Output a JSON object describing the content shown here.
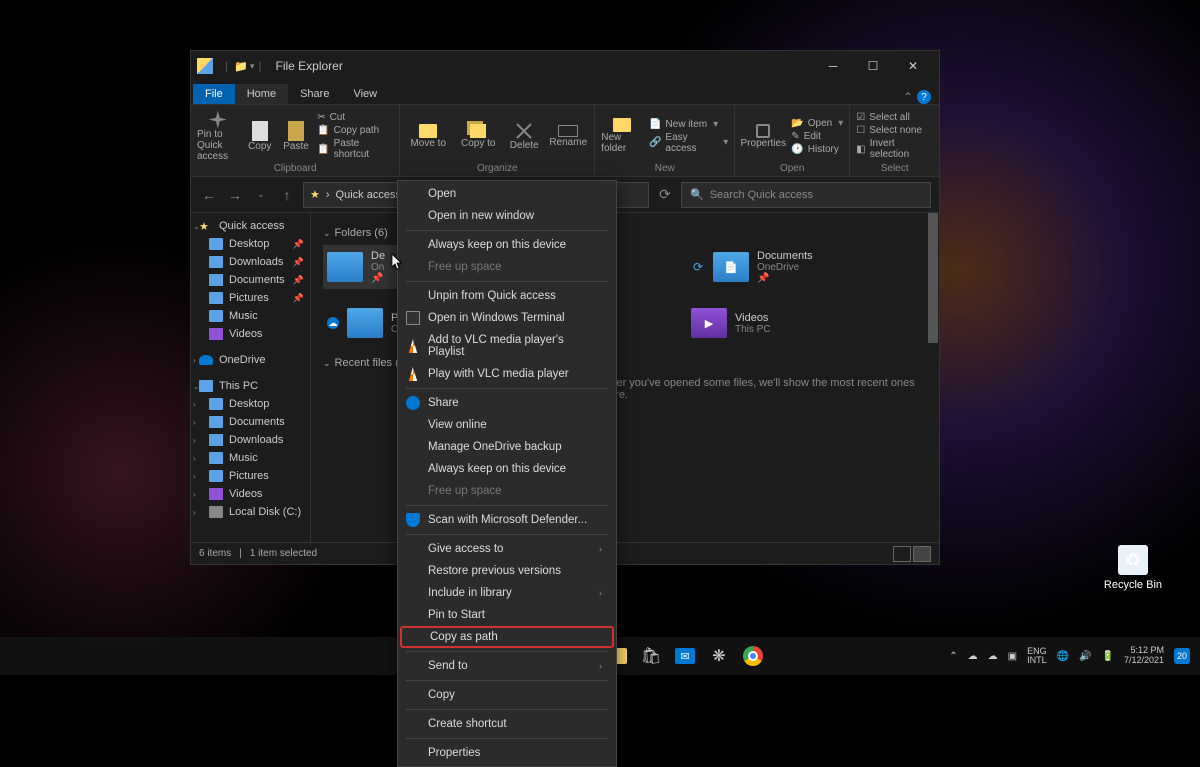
{
  "window": {
    "title": "File Explorer",
    "tabs": {
      "file": "File",
      "home": "Home",
      "share": "Share",
      "view": "View"
    },
    "ribbon": {
      "clipboard": {
        "label": "Clipboard",
        "pin": "Pin to Quick access",
        "copy": "Copy",
        "paste": "Paste",
        "cut": "Cut",
        "copy_path": "Copy path",
        "paste_shortcut": "Paste shortcut"
      },
      "organize": {
        "label": "Organize",
        "move_to": "Move to",
        "copy_to": "Copy to",
        "delete": "Delete",
        "rename": "Rename"
      },
      "new": {
        "label": "New",
        "new_folder": "New folder",
        "new_item": "New item",
        "easy_access": "Easy access"
      },
      "open": {
        "label": "Open",
        "properties": "Properties",
        "open": "Open",
        "edit": "Edit",
        "history": "History"
      },
      "select": {
        "label": "Select",
        "select_all": "Select all",
        "select_none": "Select none",
        "invert": "Invert selection"
      }
    },
    "address": {
      "location": "Quick access",
      "chevron": "›"
    },
    "search": {
      "placeholder": "Search Quick access"
    },
    "sidebar": {
      "quick_access": "Quick access",
      "desktop": "Desktop",
      "downloads": "Downloads",
      "documents": "Documents",
      "pictures": "Pictures",
      "music": "Music",
      "videos": "Videos",
      "onedrive": "OneDrive",
      "this_pc": "This PC",
      "local_disk": "Local Disk (C:)"
    },
    "main": {
      "folders_hdr": "Folders (6)",
      "recent_hdr": "Recent files (0)",
      "recent_msg": "After you've opened some files, we'll show the most recent ones here.",
      "items": {
        "desktop": {
          "name": "De",
          "sub": "On"
        },
        "documents": {
          "name": "Documents",
          "sub": "OneDrive"
        },
        "pictures": {
          "name": "Pic",
          "sub": "On"
        },
        "videos": {
          "name": "Videos",
          "sub": "This PC"
        }
      }
    },
    "status": {
      "count": "6 items",
      "selected": "1 item selected"
    }
  },
  "context_menu": {
    "open": "Open",
    "open_new": "Open in new window",
    "keep_device": "Always keep on this device",
    "free_space": "Free up space",
    "unpin": "Unpin from Quick access",
    "open_terminal": "Open in Windows Terminal",
    "vlc_add": "Add to VLC media player's Playlist",
    "vlc_play": "Play with VLC media player",
    "share": "Share",
    "view_online": "View online",
    "manage_backup": "Manage OneDrive backup",
    "keep_device2": "Always keep on this device",
    "free_space2": "Free up space",
    "scan": "Scan with Microsoft Defender...",
    "give_access": "Give access to",
    "restore": "Restore previous versions",
    "include_library": "Include in library",
    "pin_start": "Pin to Start",
    "copy_path": "Copy as path",
    "send_to": "Send to",
    "copy": "Copy",
    "create_shortcut": "Create shortcut",
    "properties": "Properties"
  },
  "desktop": {
    "recycle": "Recycle Bin"
  },
  "taskbar": {
    "lang_1": "ENG",
    "lang_2": "INTL",
    "time": "5:12 PM",
    "date": "7/12/2021",
    "notif_count": "20"
  }
}
